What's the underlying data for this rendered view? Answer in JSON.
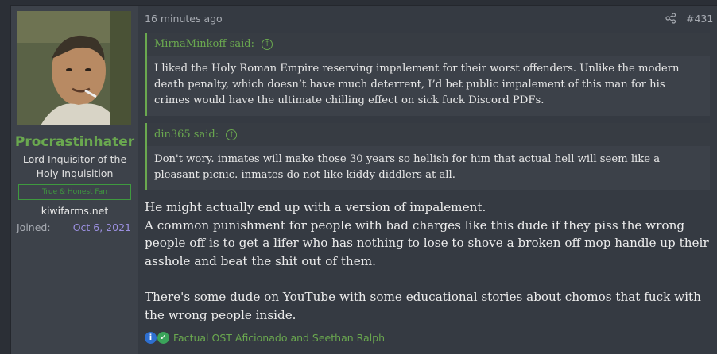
{
  "user": {
    "name": "Procrastinhater",
    "title": "Lord Inquisitor of the Holy Inquisition",
    "banner": "True & Honest Fan",
    "site": "kiwifarms.net",
    "joined_label": "Joined:",
    "joined_value": "Oct 6, 2021"
  },
  "post": {
    "time": "16 minutes ago",
    "number": "#431",
    "share_icon": "share-icon"
  },
  "quotes": [
    {
      "author": "MirnaMinkoff said:",
      "text": "I liked the Holy Roman Empire reserving impalement for their worst offenders. Unlike the modern death penalty, which doesn’t have much deterrent, I’d bet public impalement of this man for his crimes would have the ultimate chilling effect on sick fuck Discord PDFs."
    },
    {
      "author": "din365 said:",
      "text": "Don't wory. inmates will make those 30 years so hellish for him that actual hell will seem like a pleasant picnic. inmates do not like kiddy diddlers at all."
    }
  ],
  "message": {
    "line1": "He might actually end up with a version of impalement.",
    "line2": "A common punishment for people with bad charges like this dude if they piss the wrong people off is to get a lifer who has nothing to lose to shove a broken off mop handle up their asshole and beat the shit out of them.",
    "line3": "There's some dude on YouTube with some educational stories about chomos that fuck with the wrong people inside."
  },
  "reactions": {
    "icons": [
      "informative-icon",
      "agree-icon"
    ],
    "text": "Factual OST Aficionado and Seethan Ralph"
  },
  "colors": {
    "accent_green": "#6aa84f",
    "date_purple": "#9b8fe0",
    "post_bg": "#353a42",
    "user_pane_bg": "#3d424a"
  }
}
